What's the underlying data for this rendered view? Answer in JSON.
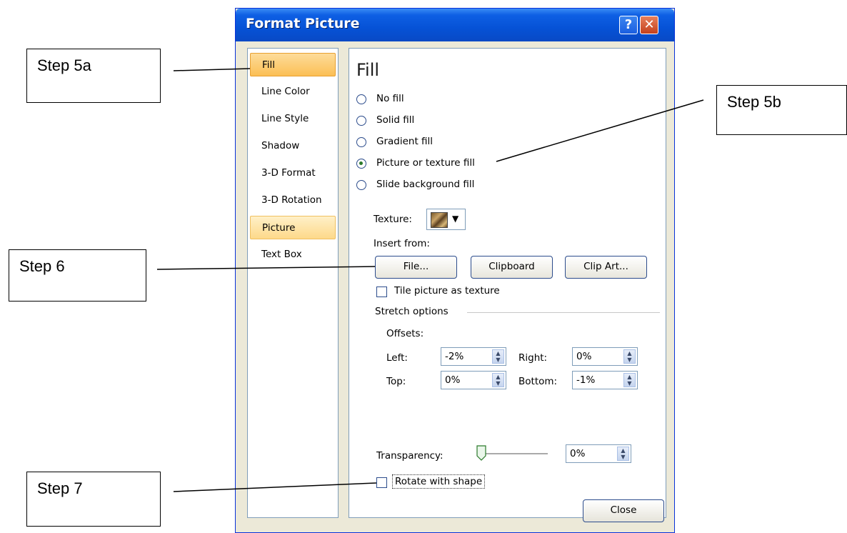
{
  "callouts": {
    "step5a": "Step 5a",
    "step5b": "Step 5b",
    "step6": "Step 6",
    "step7": "Step 7"
  },
  "dialog": {
    "title": "Format Picture",
    "help_glyph": "?",
    "close_glyph": "✕",
    "close_label": "Close"
  },
  "nav": {
    "items": [
      {
        "label": "Fill"
      },
      {
        "label": "Line Color"
      },
      {
        "label": "Line Style"
      },
      {
        "label": "Shadow"
      },
      {
        "label": "3-D Format"
      },
      {
        "label": "3-D Rotation"
      },
      {
        "label": "Picture"
      },
      {
        "label": "Text Box"
      }
    ],
    "selected": "Fill"
  },
  "fill": {
    "heading": "Fill",
    "options": [
      {
        "label": "No fill"
      },
      {
        "label": "Solid fill"
      },
      {
        "label": "Gradient fill"
      },
      {
        "label": "Picture or texture fill"
      },
      {
        "label": "Slide background fill"
      }
    ],
    "selected_option": "Picture or texture fill",
    "texture_label": "Texture:",
    "texture_dropdown": "▼",
    "insert_from_label": "Insert from:",
    "buttons": {
      "file": "File...",
      "clipboard": "Clipboard",
      "clipart": "Clip Art..."
    },
    "tile_label": "Tile picture as texture",
    "stretch_label": "Stretch options",
    "offsets_label": "Offsets:",
    "offsets": {
      "left_label": "Left:",
      "left_value": "-2%",
      "right_label": "Right:",
      "right_value": "0%",
      "top_label": "Top:",
      "top_value": "0%",
      "bottom_label": "Bottom:",
      "bottom_value": "-1%"
    },
    "transparency_label": "Transparency:",
    "transparency_value": "0%",
    "rotate_label": "Rotate with shape"
  },
  "colors": {
    "title_bar": "#0652d6",
    "selected_nav": "#fbbf55",
    "dialog_bg": "#ece9d8"
  }
}
